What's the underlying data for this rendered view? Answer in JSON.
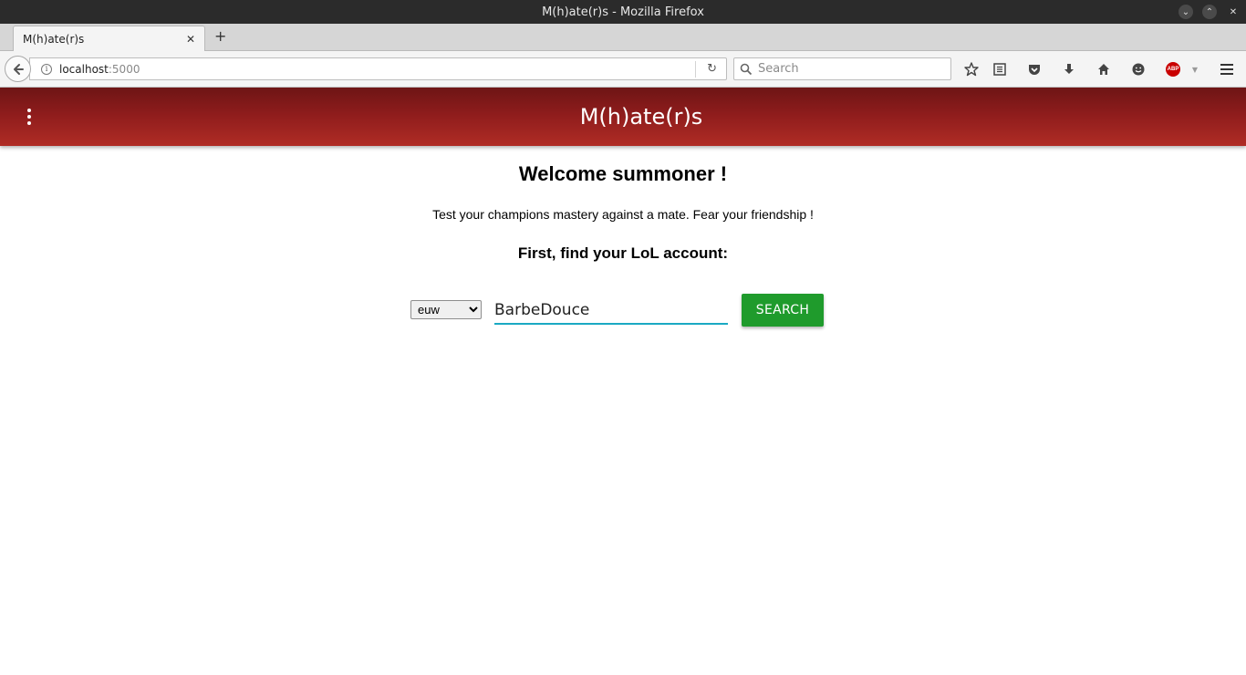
{
  "window": {
    "title": "M(h)ate(r)s - Mozilla Firefox"
  },
  "tabs": [
    {
      "label": "M(h)ate(r)s"
    }
  ],
  "navbar": {
    "url_host": "localhost",
    "url_port": ":5000",
    "search_placeholder": "Search"
  },
  "app": {
    "title": "M(h)ate(r)s",
    "header_colors": [
      "#6e1515",
      "#b02c25"
    ]
  },
  "main": {
    "welcome": "Welcome summoner !",
    "tagline": "Test your champions mastery against a mate. Fear your friendship !",
    "subhead": "First, find your LoL account:",
    "region": {
      "selected": "euw"
    },
    "summoner_input": {
      "value": "BarbeDouce"
    },
    "search_label": "SEARCH",
    "accent": "#1aa9c3",
    "button_color": "#1f9b2c"
  }
}
